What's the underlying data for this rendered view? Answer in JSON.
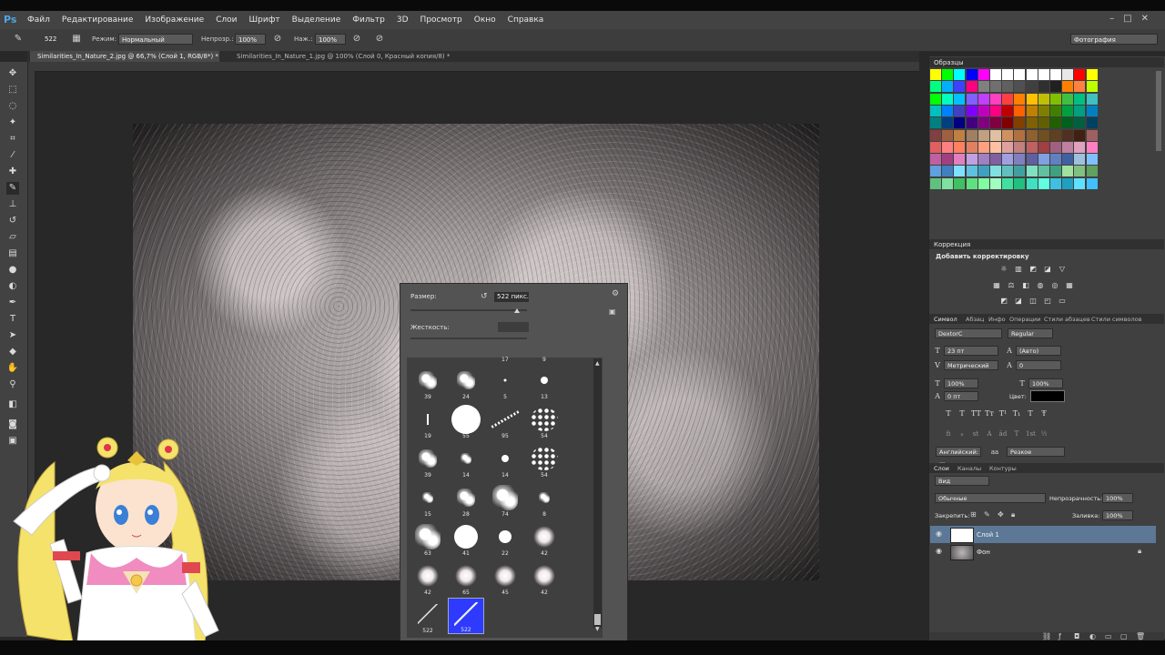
{
  "app": {
    "logo": "Ps"
  },
  "menu": [
    "Файл",
    "Редактирование",
    "Изображение",
    "Слои",
    "Шрифт",
    "Выделение",
    "Фильтр",
    "3D",
    "Просмотр",
    "Окно",
    "Справка"
  ],
  "window_controls": [
    "–",
    "□",
    "✕"
  ],
  "options": {
    "brush_size": "522",
    "mode_label": "Режим:",
    "mode_value": "Нормальный",
    "opacity_label": "Непрозр.:",
    "opacity_value": "100%",
    "flow_label": "Наж.:",
    "flow_value": "100%",
    "workspace": "Фотография"
  },
  "tabs": [
    {
      "label": "Similarities_In_Nature_2.jpg @ 66,7% (Слой 1, RGB/8*) *",
      "close": "×"
    },
    {
      "label": "Similarities_In_Nature_1.jpg @ 100% (Слой 0, Красный копия/8) *",
      "close": "×"
    }
  ],
  "brush_picker": {
    "size_label": "Размер:",
    "size_value": "522 пикс.",
    "hardness_label": "Жесткость:",
    "top_row_numbers": [
      "17",
      "9"
    ],
    "brushes": [
      {
        "n": "39",
        "kind": "splat"
      },
      {
        "n": "24",
        "kind": "splat"
      },
      {
        "n": "5",
        "kind": "dot"
      },
      {
        "n": "13",
        "kind": "dot"
      },
      {
        "n": "19",
        "kind": "line"
      },
      {
        "n": "55",
        "kind": "hard"
      },
      {
        "n": "95",
        "kind": "dashes"
      },
      {
        "n": "54",
        "kind": "dots"
      },
      {
        "n": "39",
        "kind": "splat"
      },
      {
        "n": "14",
        "kind": "splat"
      },
      {
        "n": "14",
        "kind": "dot"
      },
      {
        "n": "54",
        "kind": "dots"
      },
      {
        "n": "15",
        "kind": "splat"
      },
      {
        "n": "28",
        "kind": "splat"
      },
      {
        "n": "74",
        "kind": "splat"
      },
      {
        "n": "8",
        "kind": "splat"
      },
      {
        "n": "63",
        "kind": "splat"
      },
      {
        "n": "41",
        "kind": "hard"
      },
      {
        "n": "22",
        "kind": "hard"
      },
      {
        "n": "42",
        "kind": "soft"
      },
      {
        "n": "42",
        "kind": "soft"
      },
      {
        "n": "65",
        "kind": "soft"
      },
      {
        "n": "45",
        "kind": "soft"
      },
      {
        "n": "42",
        "kind": "soft"
      },
      {
        "n": "522",
        "kind": "custom"
      },
      {
        "n": "522",
        "kind": "selected"
      }
    ]
  },
  "panels": {
    "swatches_title": "Образцы",
    "adjustments_title": "Коррекция",
    "adjustments_hint": "Добавить корректировку",
    "char_tabs": [
      "Символ",
      "Абзац",
      "Инфо",
      "Операции",
      "Стили абзацев",
      "Стили символов"
    ],
    "font_family": "DextorC",
    "font_style": "Regular",
    "font_size": "23 пт",
    "leading": "(Авто)",
    "kerning": "Метрический",
    "tracking": "0",
    "vscale": "100%",
    "hscale": "100%",
    "baseline": "0 пт",
    "color_label": "Цвет:",
    "text_styles": [
      "T",
      "T",
      "TT",
      "Tт",
      "T¹",
      "T₁",
      "T",
      "Ŧ"
    ],
    "ot_features": [
      "fi",
      "ℴ",
      "st",
      "A",
      "ād",
      "T",
      "1st",
      "½"
    ],
    "language": "Английский: ...",
    "aa_label": "аа",
    "antialias": "Резкое",
    "layers_tabs": [
      "Слои",
      "Каналы",
      "Контуры"
    ],
    "filter_kind": "Вид",
    "blend_mode": "Обычные",
    "opacity_label": "Непрозрачность:",
    "opacity_value": "100%",
    "lock_label": "Закрепить:",
    "fill_label": "Заливка:",
    "fill_value": "100%",
    "layers": [
      {
        "name": "Слой 1",
        "selected": true
      },
      {
        "name": "Фон",
        "selected": false
      }
    ]
  },
  "swatch_colors": [
    [
      "#ffff00",
      "#00ff00",
      "#00ffff",
      "#0000ff",
      "#ff00ff",
      "#ffffff",
      "#ffffff",
      "#ffffff",
      "#ffffff",
      "#ffffff",
      "#ffffff",
      "#e8e8e8",
      "#ff0000",
      "#ffff00"
    ],
    [
      "#00ff80",
      "#00b0ff",
      "#4040ff",
      "#ff0080",
      "#808080",
      "#707070",
      "#606060",
      "#505050",
      "#404040",
      "#303030",
      "#202020",
      "#ff8000",
      "#ff8040",
      "#c0ff00"
    ],
    [
      "#00ff00",
      "#00ffc0",
      "#00c0ff",
      "#8060ff",
      "#c040ff",
      "#ff40c0",
      "#ff4040",
      "#ff8000",
      "#ffc000",
      "#c0c000",
      "#80c000",
      "#40c040",
      "#00c080",
      "#40c0c0"
    ],
    [
      "#00c0c0",
      "#0080ff",
      "#4040c0",
      "#8000ff",
      "#c000c0",
      "#ff0080",
      "#c00000",
      "#ff6000",
      "#c08000",
      "#808000",
      "#408000",
      "#00a040",
      "#00a080",
      "#0080c0"
    ],
    [
      "#008080",
      "#004080",
      "#000080",
      "#400080",
      "#800080",
      "#800040",
      "#800000",
      "#804000",
      "#806000",
      "#606000",
      "#206000",
      "#006020",
      "#006040",
      "#004060"
    ],
    [
      "#804040",
      "#a06040",
      "#c08040",
      "#a08060",
      "#c0a080",
      "#e0c0a0",
      "#d09060",
      "#b07040",
      "#906030",
      "#705020",
      "#604020",
      "#503020",
      "#402010",
      "#a06060"
    ],
    [
      "#e06060",
      "#ff8080",
      "#ff8060",
      "#e08060",
      "#ffa080",
      "#ffc0a0",
      "#e0a0a0",
      "#c08080",
      "#c06060",
      "#a04040",
      "#a06080",
      "#c080a0",
      "#e0a0c0",
      "#ff80c0"
    ],
    [
      "#c060a0",
      "#a04080",
      "#e080c0",
      "#c0a0e0",
      "#a080c0",
      "#8060a0",
      "#a0a0e0",
      "#8080c0",
      "#6060a0",
      "#80a0e0",
      "#6080c0",
      "#4060a0",
      "#a0c0e0",
      "#80c0ff"
    ],
    [
      "#60a0e0",
      "#4080c0",
      "#80e0ff",
      "#60c0e0",
      "#40a0c0",
      "#80e0e0",
      "#60c0c0",
      "#40a0a0",
      "#80e0c0",
      "#60c0a0",
      "#40a080",
      "#a0e0a0",
      "#80c080",
      "#60a060"
    ],
    [
      "#60c080",
      "#80e0a0",
      "#40c060",
      "#60e080",
      "#80ffa0",
      "#a0ffc0",
      "#40e0a0",
      "#20c080",
      "#40e0c0",
      "#60ffe0",
      "#40c0e0",
      "#20a0c0",
      "#60e0ff",
      "#40c0ff"
    ]
  ],
  "colors": {
    "accent": "#5c7896",
    "selected_brush": "#2f3aff",
    "logo": "#4ea6e8"
  },
  "icons": {
    "tools": [
      "move-icon",
      "marquee-icon",
      "lasso-icon",
      "magic-wand-icon",
      "crop-icon",
      "eyedropper-icon",
      "healing-icon",
      "brush-icon",
      "stamp-icon",
      "history-brush-icon",
      "eraser-icon",
      "gradient-icon",
      "blur-icon",
      "dodge-icon",
      "pen-icon",
      "type-icon",
      "path-select-icon",
      "shape-icon",
      "hand-icon",
      "zoom-icon",
      "colors-icon",
      "quickmask-icon",
      "screenmode-icon"
    ]
  }
}
